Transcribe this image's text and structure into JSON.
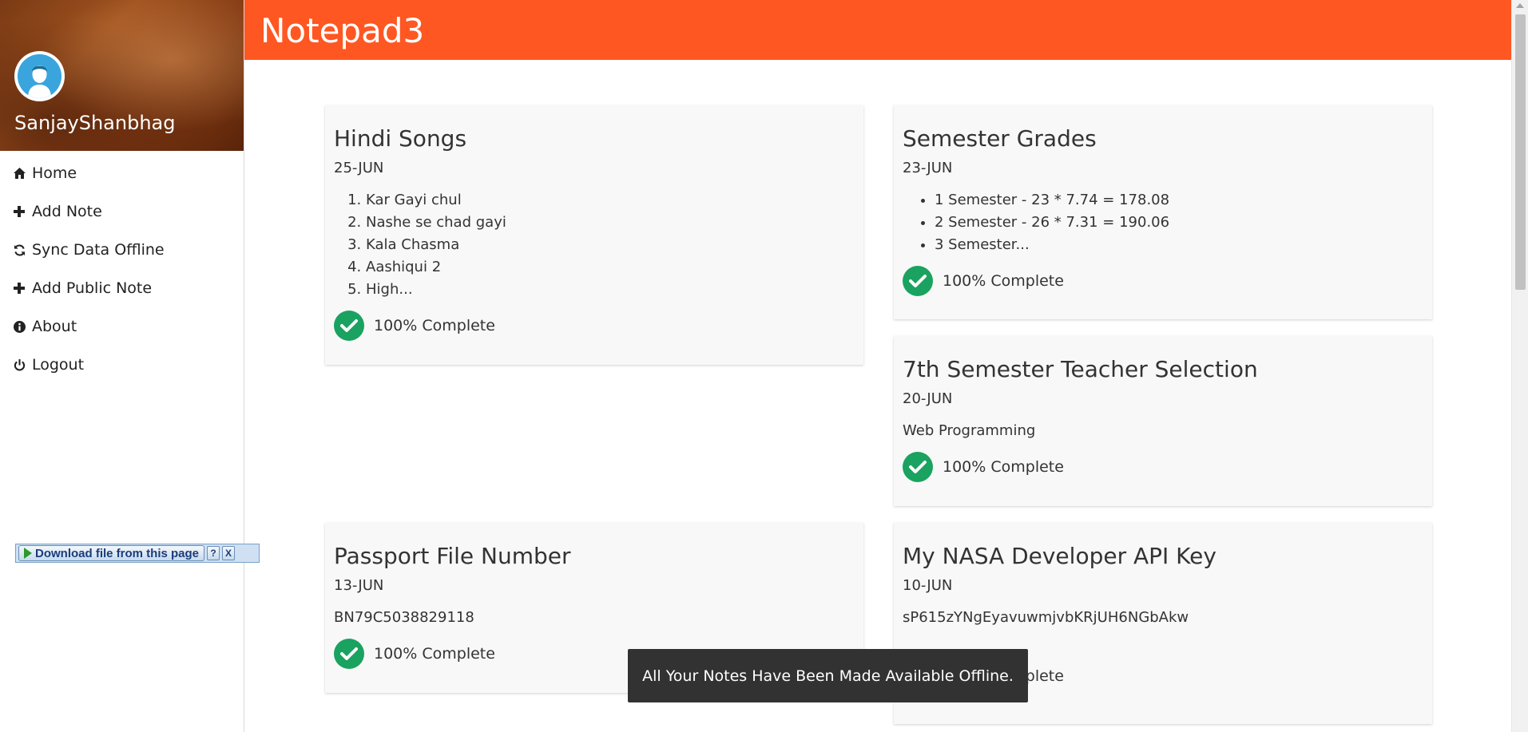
{
  "app": {
    "title": "Notepad3"
  },
  "profile": {
    "username": "SanjayShanbhag"
  },
  "sidebar": {
    "items": [
      {
        "icon": "home-icon",
        "label": "Home"
      },
      {
        "icon": "plus-icon",
        "label": "Add Note"
      },
      {
        "icon": "refresh-icon",
        "label": "Sync Data Offline"
      },
      {
        "icon": "plus-icon",
        "label": "Add Public Note"
      },
      {
        "icon": "info-icon",
        "label": "About"
      },
      {
        "icon": "power-icon",
        "label": "Logout"
      }
    ]
  },
  "notes": [
    {
      "title": "Hindi Songs",
      "date": "25-JUN",
      "list_type": "ordered",
      "items": [
        "Kar Gayi chul",
        "Nashe se chad gayi",
        "Kala Chasma",
        "Aashiqui 2",
        "High..."
      ],
      "status": "100% Complete"
    },
    {
      "title": "Semester Grades",
      "date": "23-JUN",
      "list_type": "unordered",
      "items": [
        "1 Semester - 23 * 7.74 = 178.08",
        "2 Semester - 26 * 7.31 = 190.06",
        "3 Semester..."
      ],
      "status": "100% Complete"
    },
    {
      "title": "7th Semester Teacher Selection",
      "date": "20-JUN",
      "text": "Web Programming",
      "status": "100% Complete"
    },
    {
      "title": "Passport File Number",
      "date": "13-JUN",
      "text": "BN79C5038829118",
      "status": "100% Complete"
    },
    {
      "title": "My NASA Developer API Key",
      "date": "10-JUN",
      "text": "sP615zYNgEyavuwmjvbKRjUH6NGbAkw",
      "status": "100% Complete"
    }
  ],
  "toast": {
    "message": "All Your Notes Have Been Made Available Offline."
  },
  "download_bar": {
    "label": "Download file from this page",
    "help": "?",
    "close": "X"
  },
  "colors": {
    "header": "#ff5722",
    "check": "#1aa260",
    "toast": "#323232"
  }
}
